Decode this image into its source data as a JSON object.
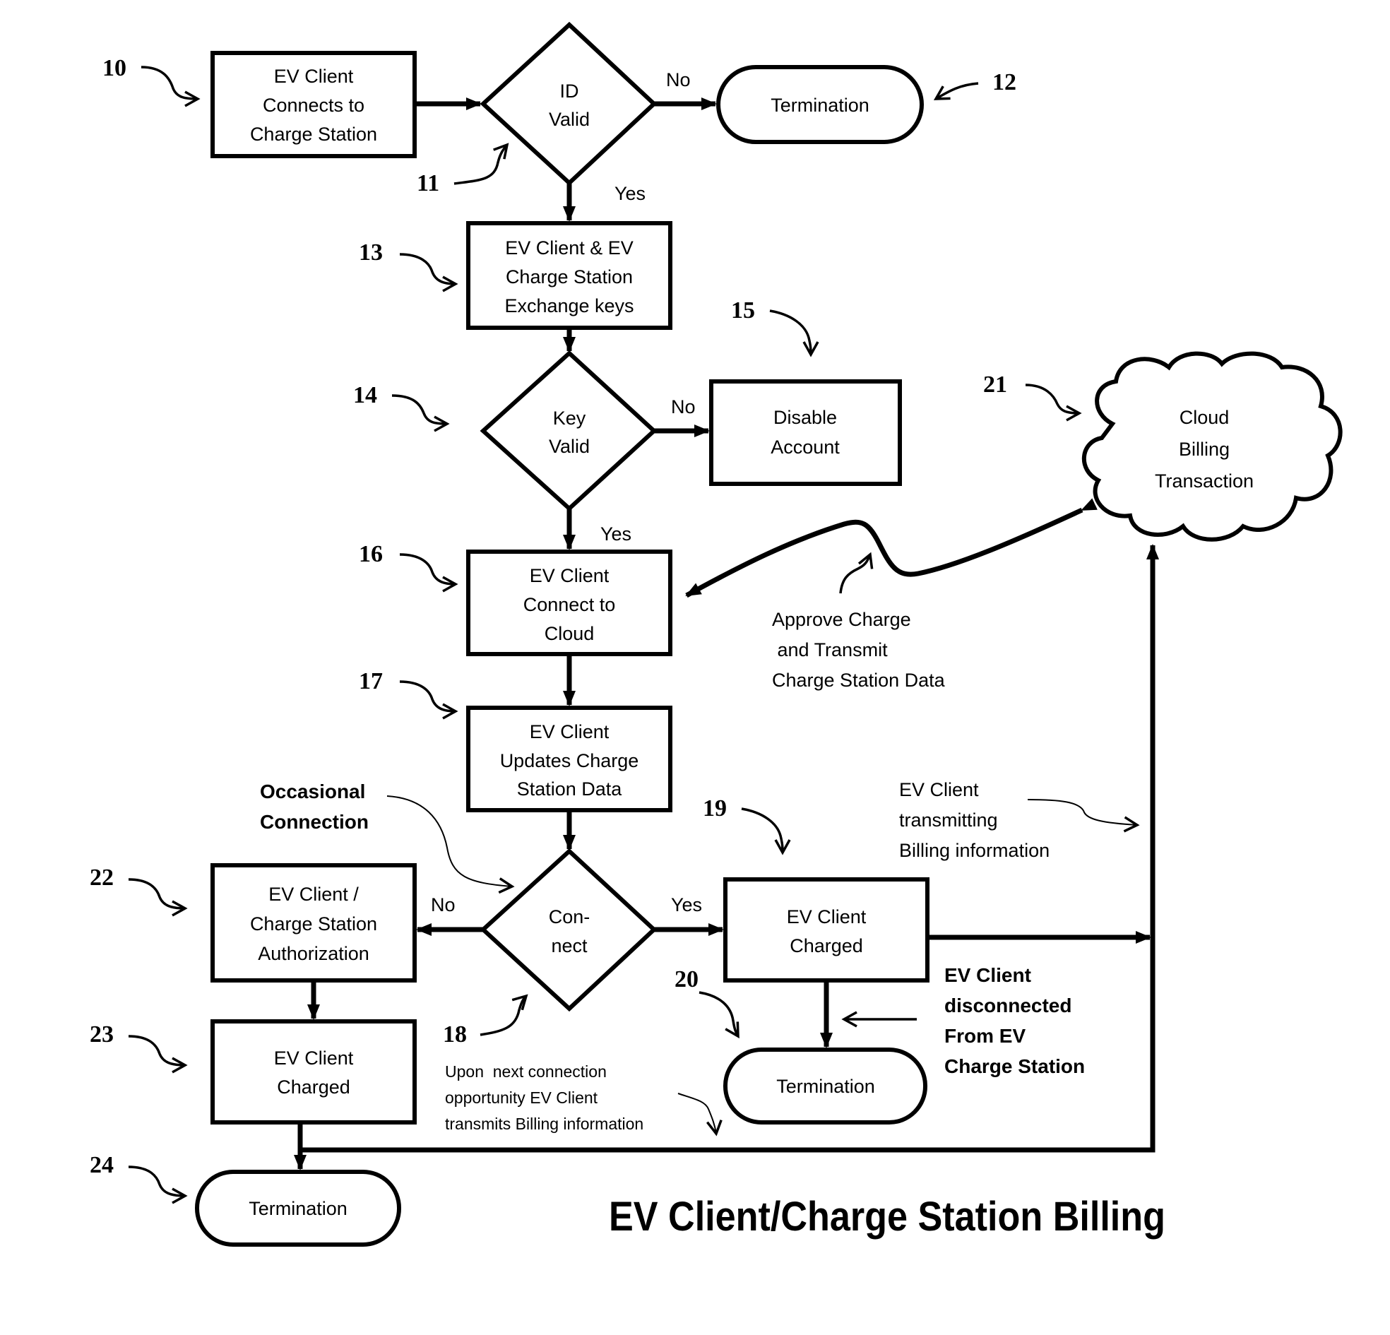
{
  "title": "EV Client/Charge Station Billing",
  "nodes": {
    "n10": {
      "ref": "10",
      "lines": [
        "EV Client",
        "Connects to",
        "Charge Station"
      ]
    },
    "n11": {
      "ref": "11",
      "lines": [
        "ID",
        "Valid"
      ]
    },
    "n12": {
      "ref": "12",
      "lines": [
        "Termination"
      ]
    },
    "n13": {
      "ref": "13",
      "lines": [
        "EV Client & EV",
        "Charge Station",
        "Exchange keys"
      ]
    },
    "n14": {
      "ref": "14",
      "lines": [
        "Key",
        "Valid"
      ]
    },
    "n15": {
      "ref": "15",
      "lines": [
        "Disable",
        "Account"
      ]
    },
    "n16": {
      "ref": "16",
      "lines": [
        "EV Client",
        "Connect to",
        "Cloud"
      ]
    },
    "n17": {
      "ref": "17",
      "lines": [
        "EV Client",
        "Updates Charge",
        "Station Data"
      ]
    },
    "n18": {
      "ref": "18",
      "lines": [
        "Con-",
        "nect"
      ]
    },
    "n19": {
      "ref": "19",
      "lines": [
        "EV Client",
        "Charged"
      ]
    },
    "n20": {
      "ref": "20",
      "lines": [
        "Termination"
      ]
    },
    "n21": {
      "ref": "21",
      "lines": [
        "Cloud",
        "Billing",
        "Transaction"
      ]
    },
    "n22": {
      "ref": "22",
      "lines": [
        "EV Client /",
        "Charge Station",
        "Authorization"
      ]
    },
    "n23": {
      "ref": "23",
      "lines": [
        "EV Client",
        "Charged"
      ]
    },
    "n24": {
      "ref": "24",
      "lines": [
        "Termination"
      ]
    }
  },
  "edge_labels": {
    "id_no": "No",
    "id_yes": "Yes",
    "key_no": "No",
    "key_yes": "Yes",
    "connect_no": "No",
    "connect_yes": "Yes"
  },
  "annotations": {
    "approve": [
      "Approve Charge",
      " and Transmit",
      "Charge Station Data"
    ],
    "occasional": [
      "Occasional",
      "Connection"
    ],
    "transmitting": [
      "EV Client",
      "transmitting",
      "Billing information"
    ],
    "disconnected": [
      "EV Client",
      "disconnected",
      "From EV",
      "Charge Station"
    ],
    "next_connection": [
      "Upon  next connection",
      "opportunity EV Client",
      "transmits Billing information"
    ]
  }
}
